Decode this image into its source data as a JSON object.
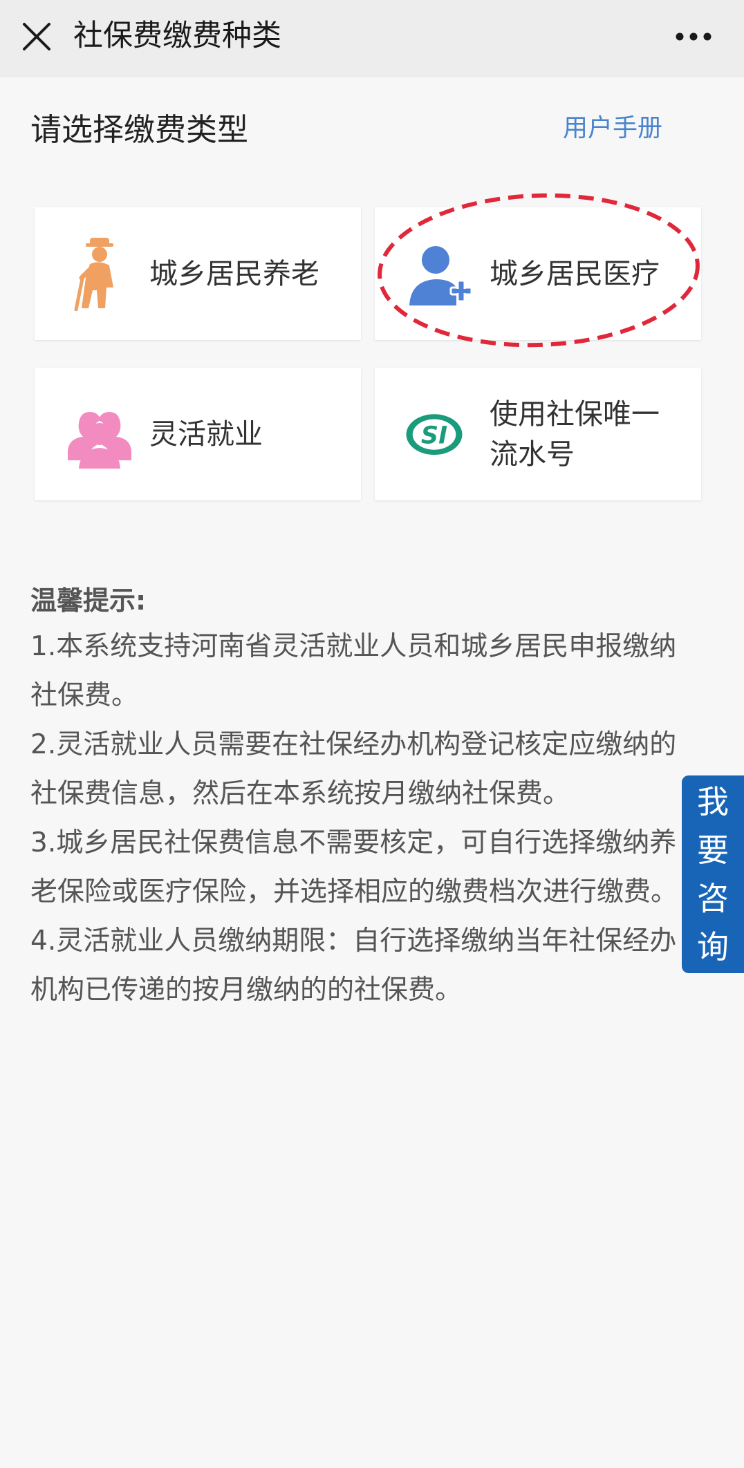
{
  "header": {
    "title": "社保费缴费种类",
    "close_icon": "close-icon",
    "more_icon": "more-icon"
  },
  "section": {
    "title": "请选择缴费类型",
    "manual_link": "用户手册"
  },
  "cards": [
    {
      "label": "城乡居民养老",
      "icon": "elderly-person-icon",
      "color": "#f0a061"
    },
    {
      "label": "城乡居民医疗",
      "icon": "user-add-icon",
      "color": "#4f82d4"
    },
    {
      "label": "灵活就业",
      "icon": "people-group-icon",
      "color": "#f28bc0"
    },
    {
      "label": "使用社保唯一流水号",
      "icon": "si-logo-icon",
      "color": "#1a9c7c"
    }
  ],
  "tips": {
    "title": "温馨提示:",
    "items": [
      "1.本系统支持河南省灵活就业人员和城乡居民申报缴纳社保费。",
      "2.灵活就业人员需要在社保经办机构登记核定应缴纳的社保费信息，然后在本系统按月缴纳社保费。",
      "3.城乡居民社保费信息不需要核定，可自行选择缴纳养老保险或医疗保险，并选择相应的缴费档次进行缴费。",
      "4.灵活就业人员缴纳期限：自行选择缴纳当年社保经办机构已传递的按月缴纳的的社保费。"
    ]
  },
  "consult_button": {
    "label": "我要咨询",
    "color": "#1865b8"
  },
  "colors": {
    "link": "#4a84cc",
    "annotation": "#e0283a"
  }
}
